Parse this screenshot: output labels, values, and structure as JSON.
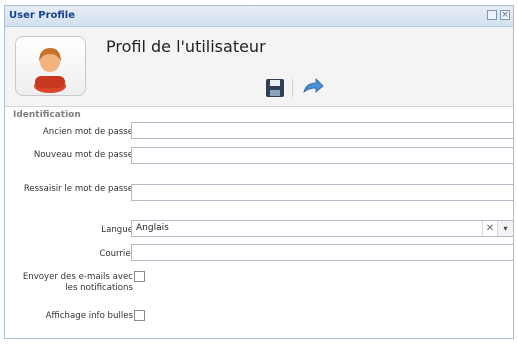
{
  "window": {
    "title": "User Profile",
    "restore_icon": "restore-icon",
    "close_icon": "close-icon"
  },
  "header": {
    "heading": "Profil de l'utilisateur",
    "avatar_icon": "user-avatar-icon",
    "save_icon": "floppy-disk-icon",
    "refresh_icon": "refresh-icon"
  },
  "section": {
    "title": "Identification"
  },
  "form": {
    "old_password": {
      "label": "Ancien mot de passe",
      "value": ""
    },
    "new_password": {
      "label": "Nouveau mot de passe",
      "value": ""
    },
    "retype_password": {
      "label": "Ressaisir le mot de passe",
      "value": ""
    },
    "language": {
      "label": "Langue",
      "value": "Anglais",
      "clear_glyph": "✕",
      "arrow_glyph": "▾"
    },
    "email": {
      "label": "Courriel",
      "value": ""
    },
    "send_emails": {
      "label": "Envoyer des e-mails avec les notifications",
      "checked": false
    },
    "tooltips": {
      "label": "Affichage info bulles",
      "checked": false
    }
  },
  "colors": {
    "accent": "#15428b",
    "border": "#a9bfd6"
  }
}
